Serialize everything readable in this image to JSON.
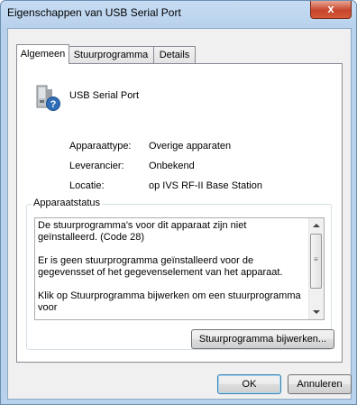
{
  "window": {
    "title": "Eigenschappen van USB Serial Port",
    "close_label": "x"
  },
  "tabs": [
    {
      "label": "Algemeen",
      "active": true
    },
    {
      "label": "Stuurprogramma",
      "active": false
    },
    {
      "label": "Details",
      "active": false
    }
  ],
  "device": {
    "icon": "usb-device-question-icon",
    "name": "USB Serial Port"
  },
  "properties": [
    {
      "label": "Apparaattype:",
      "value": "Overige apparaten"
    },
    {
      "label": "Leverancier:",
      "value": "Onbekend"
    },
    {
      "label": "Locatie:",
      "value": "op IVS RF-II Base Station"
    }
  ],
  "status": {
    "group_label": "Apparaatstatus",
    "paragraphs": [
      "De stuurprogramma's voor dit apparaat zijn niet geïnstalleerd. (Code 28)",
      "Er is geen stuurprogramma geïnstalleerd voor de gegevensset of het gegevenselement van het apparaat.",
      "Klik op Stuurprogramma bijwerken om een stuurprogramma voor"
    ],
    "update_button": "Stuurprogramma bijwerken..."
  },
  "footer": {
    "ok_label": "OK",
    "cancel_label": "Annuleren"
  }
}
